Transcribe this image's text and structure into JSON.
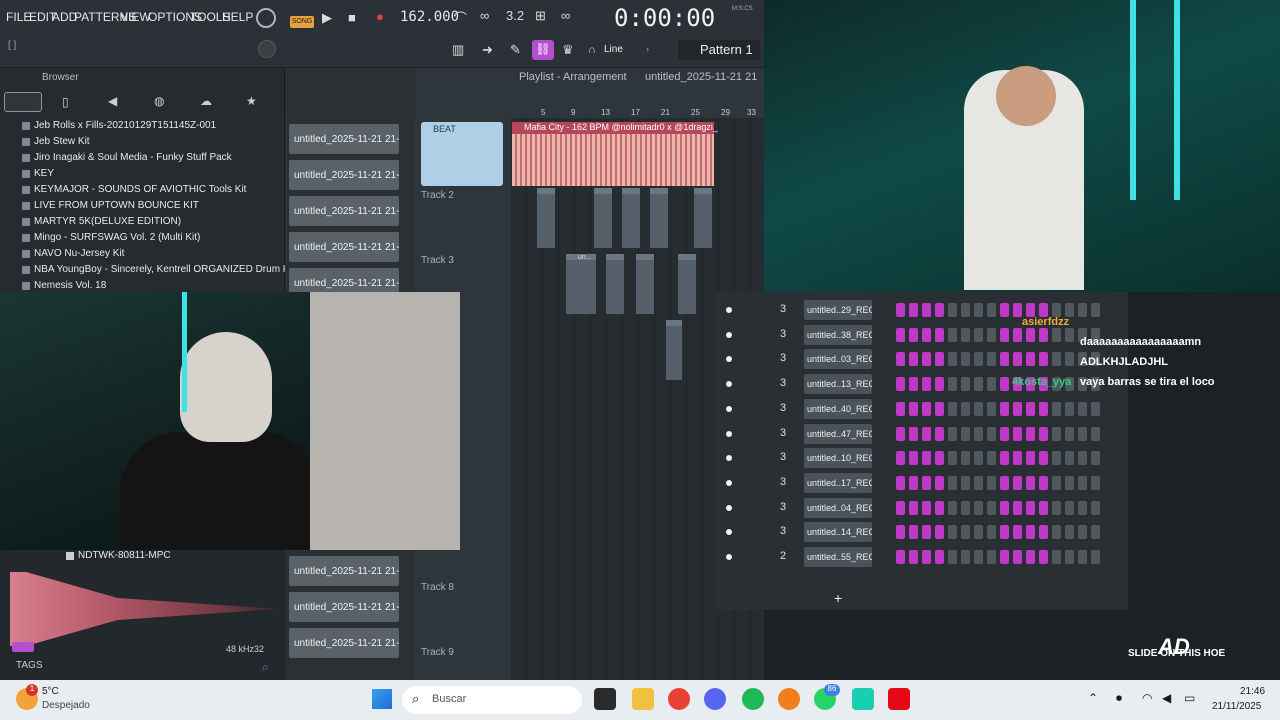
{
  "menu": [
    "FILE",
    "EDIT",
    "ADD",
    "PATTERNS",
    "VIEW",
    "OPTIONS",
    "TOOLS",
    "HELP"
  ],
  "transport": {
    "mode": "SONG",
    "tempo": "162.000",
    "time": "0:00:00",
    "time_unit": "M:S:CS"
  },
  "toolbar": {
    "snap": "Line",
    "pattern": "Pattern 1",
    "hint": "[ ]"
  },
  "browser": {
    "title": "Browser",
    "items": [
      "Jeb Rolls x Fills-20210129T151145Z-001",
      "Jeb Stew Kit",
      "Jiro Inagaki & Soul Media - Funky Stuff Pack",
      "KEY",
      "KEYMAJOR - SOUNDS OF AVIOTHIC Tools Kit",
      "LIVE FROM UPTOWN BOUNCE KIT",
      "MARTYR 5K(DELUXE EDITION)",
      "Mingo - SURFSWAG Vol. 2 (Multi Kit)",
      "NAVO Nu-Jersey Kit",
      "NBA YoungBoy - Sincerely, Kentrell ORGANIZED Drum Kit",
      "Nemesis Vol. 18"
    ]
  },
  "playlist": {
    "title": "Playlist - Arrangement",
    "file": "untitled_2025-11-21 21",
    "ruler": [
      "5",
      "9",
      "13",
      "17",
      "21",
      "25",
      "29",
      "33"
    ],
    "beat_label": "BEAT",
    "beat_clip": "Mafia City - 162 BPM @nolimitadr0 x @1dragzi_",
    "tracks": [
      "Track 2",
      "Track 3",
      "Track 8",
      "Track 9"
    ],
    "clip_small": "un..."
  },
  "channels": [
    "untitled_2025-11-21 21-...",
    "untitled_2025-11-21 21-...",
    "untitled_2025-11-21 21-...",
    "untitled_2025-11-21 21-...",
    "untitled_2025-11-21 21-..."
  ],
  "channels_bottom": [
    "untitled_2025-11-21 21-...",
    "untitled_2025-11-21 21-...",
    "untitled_2025-11-21 21-..."
  ],
  "steprack": {
    "rows": [
      {
        "num": "3",
        "name": "untitled..29_REC"
      },
      {
        "num": "3",
        "name": "untitled..38_REC"
      },
      {
        "num": "3",
        "name": "untitled..03_REC"
      },
      {
        "num": "3",
        "name": "untitled..13_REC"
      },
      {
        "num": "3",
        "name": "untitled..40_REC"
      },
      {
        "num": "3",
        "name": "untitled..47_REC"
      },
      {
        "num": "3",
        "name": "untitled..10_REC"
      },
      {
        "num": "3",
        "name": "untitled..17_REC"
      },
      {
        "num": "3",
        "name": "untitled..04_REC"
      },
      {
        "num": "3",
        "name": "untitled..14_REC"
      },
      {
        "num": "2",
        "name": "untitled..55_REC"
      }
    ],
    "add": "+"
  },
  "chat": [
    {
      "user": "asierfdzz",
      "msg": "",
      "color": "#f2a93b"
    },
    {
      "user": "",
      "msg": "daaaaaaaaaaaaaaaamn",
      "color": "#e0232f"
    },
    {
      "user": "",
      "msg": "ADLKHJLADJHL",
      "color": "#e0232f"
    },
    {
      "user": "4kosta_yya",
      "msg": "vaya barras se tira el loco",
      "color": "#2fd07a"
    }
  ],
  "sample": {
    "name": "NDTWK-80811-MPC",
    "rate": "48 kHz",
    "bits": "32",
    "tags": "TAGS"
  },
  "watermark": {
    "logo": "AD",
    "text": "SLIDE ON THIS HOE"
  },
  "taskbar": {
    "weather_temp": "5°C",
    "weather_desc": "Despejado",
    "weather_badge": "1",
    "search": "Buscar",
    "whatsapp_badge": "86",
    "time": "21:46",
    "date": "21/11/2025"
  },
  "colors": {
    "step_on": "#c038c8",
    "step_off": "#51585e",
    "accent": "#e0a040"
  }
}
